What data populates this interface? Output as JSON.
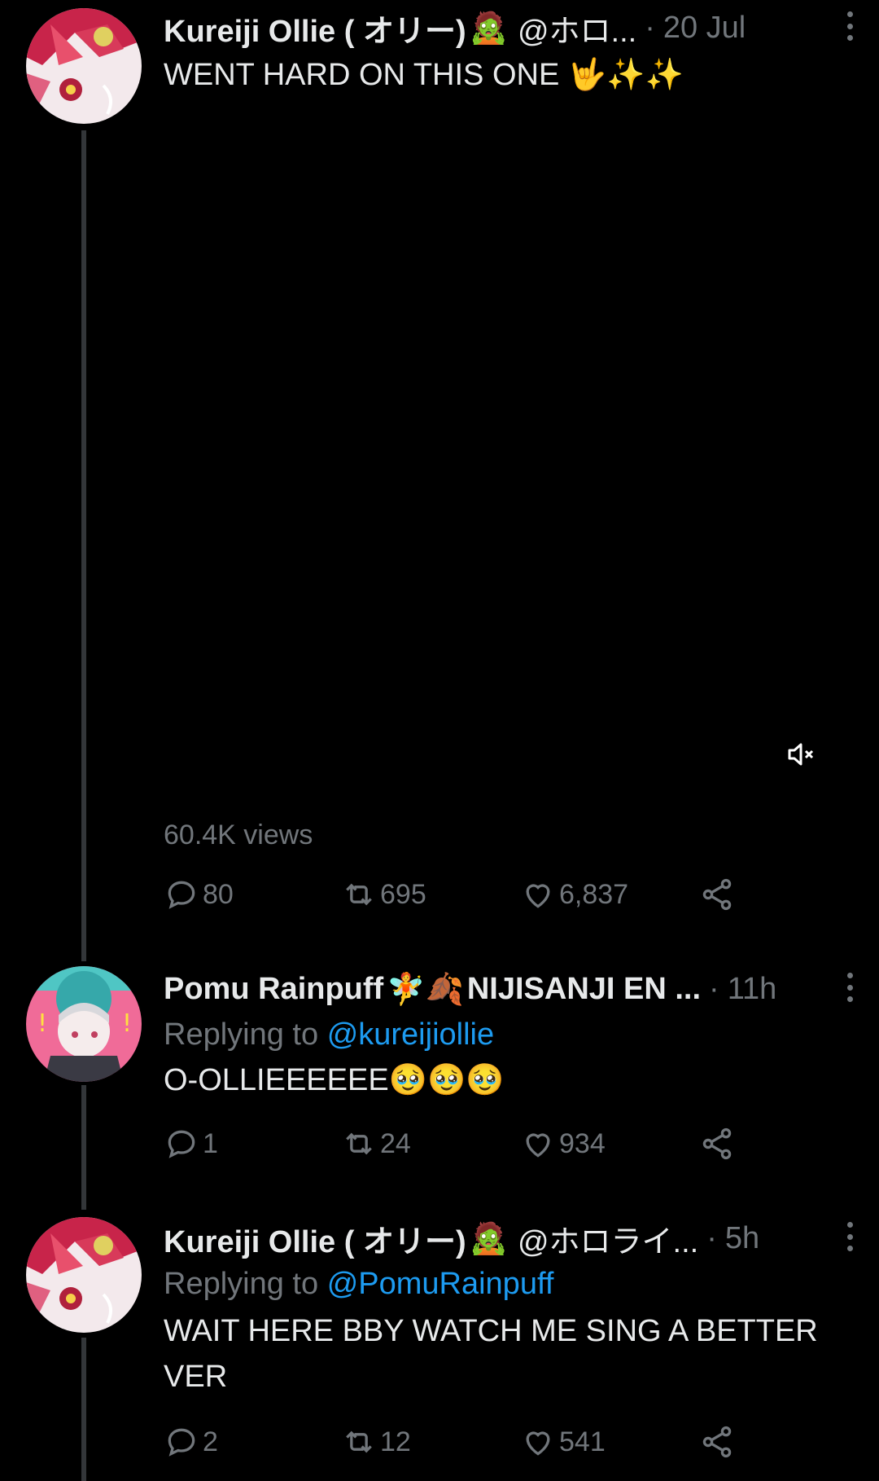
{
  "tweets": [
    {
      "display_name": "Kureiji Ollie ( オリー)",
      "name_emoji": "🧟",
      "handle": "@ホロ...",
      "time": "20 Jul",
      "text": "WENT HARD ON THIS ONE 🤟✨✨",
      "views": "60.4K views",
      "replies": "80",
      "retweets": "695",
      "likes": "6,837"
    },
    {
      "display_name": "Pomu Rainpuff",
      "name_emoji": "🧚🍂",
      "name_suffix": "NIJISANJI EN ...",
      "time": "11h",
      "reply_label": "Replying to",
      "reply_mention": "@kureijiollie",
      "text": "O-OLLIEEEEEE🥹🥹🥹",
      "replies": "1",
      "retweets": "24",
      "likes": "934"
    },
    {
      "display_name": "Kureiji Ollie ( オリー)",
      "name_emoji": "🧟",
      "handle": "@ホロライ...",
      "time": "5h",
      "reply_label": "Replying to",
      "reply_mention": "@PomuRainpuff",
      "text": "WAIT HERE BBY WATCH ME SING A BETTER VER",
      "replies": "2",
      "retweets": "12",
      "likes": "541"
    }
  ],
  "colors": {
    "background": "#000000",
    "text": "#e7e9ea",
    "muted": "#71767b",
    "link": "#1d9bf0",
    "thread_line": "#333639"
  },
  "icons": [
    "more-icon",
    "mute-icon",
    "reply-icon",
    "retweet-icon",
    "like-icon",
    "share-icon"
  ]
}
